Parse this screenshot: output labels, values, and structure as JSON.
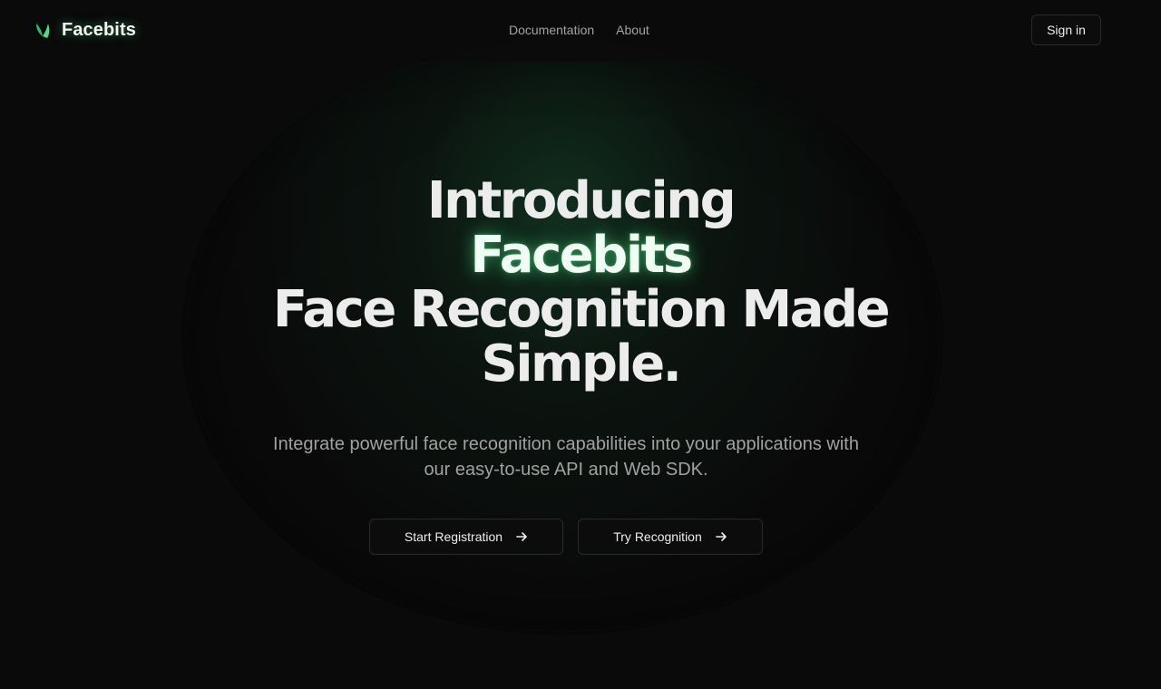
{
  "brand": {
    "name": "Facebits",
    "icon": "leaf-logo-icon",
    "accent_color": "#4ade80"
  },
  "nav": {
    "items": [
      {
        "label": "Documentation"
      },
      {
        "label": "About"
      }
    ]
  },
  "header": {
    "signin_label": "Sign in"
  },
  "hero": {
    "line1": "Introducing",
    "line2": "Facebits",
    "line3": "Face Recognition Made",
    "line4": "Simple.",
    "subtitle": "Integrate powerful face recognition capabilities into your applications with our easy-to-use API and Web SDK.",
    "cta_primary": "Start Registration",
    "cta_secondary": "Try Recognition",
    "cta_icon": "arrow-right-icon"
  }
}
